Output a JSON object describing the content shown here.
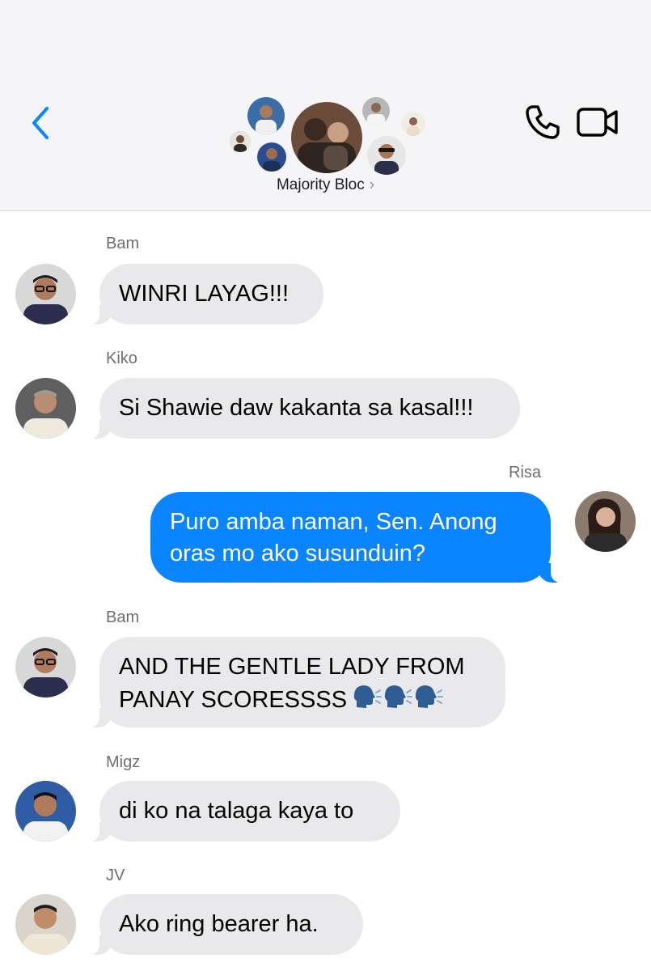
{
  "header": {
    "title": "Majority Bloc",
    "chevron": "›",
    "icons": [
      "back-chevron-icon",
      "phone-icon",
      "video-camera-icon"
    ],
    "accent": "#0a84ff"
  },
  "messages": [
    {
      "sender": "Bam",
      "text": "WINRI LAYAG!!!",
      "direction": "incoming"
    },
    {
      "sender": "Kiko",
      "text": "Si Shawie daw kakanta sa kasal!!!",
      "direction": "incoming"
    },
    {
      "sender": "Risa",
      "text_lines": [
        "Puro amba naman, Sen. Anong",
        "oras mo ako susunduin?"
      ],
      "direction": "outgoing"
    },
    {
      "sender": "Bam",
      "text_lines": [
        "AND THE GENTLE LADY FROM",
        "PANAY SCORESSSS"
      ],
      "emoji": "speaking-head-icon x3",
      "direction": "incoming"
    },
    {
      "sender": "Migz",
      "text": "di ko na talaga kaya to",
      "direction": "incoming"
    },
    {
      "sender": "JV",
      "text": "Ako ring bearer ha.",
      "direction": "incoming"
    }
  ],
  "colors": {
    "incoming_bubble": "#e9e9eb",
    "outgoing_bubble": "#0a84ff",
    "header_bg": "#f5f5f7"
  }
}
